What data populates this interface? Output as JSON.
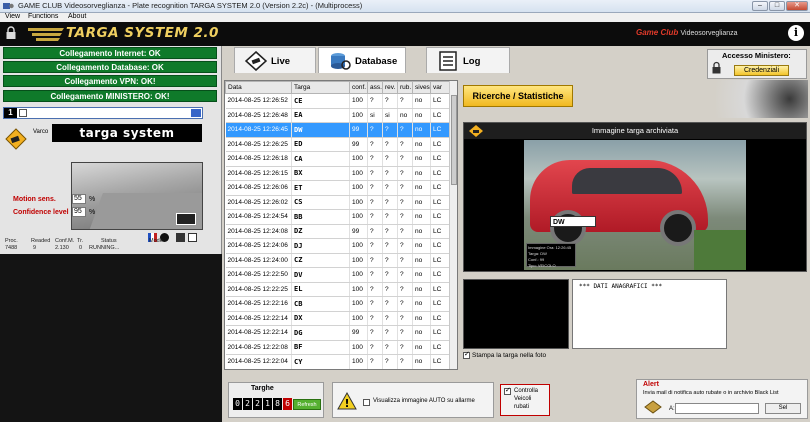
{
  "window": {
    "title": "GAME CLUB Videosorveglianza - Plate recognition TARGA SYSTEM 2.0 (Version 2.2c) - (Multiprocess)",
    "controls": [
      "–",
      "□",
      "✕"
    ]
  },
  "menu": [
    "View",
    "Functions",
    "About"
  ],
  "header": {
    "logo": "TARGA SYSTEM 2.0",
    "brand": "Game Club",
    "brand_sub": "Videosorveglianza",
    "info": "i"
  },
  "status": [
    "Collegamento Internet: OK",
    "Collegamento Database: OK",
    "Collegamento VPN: OK!",
    "Collegamento MINISTERO: OK!"
  ],
  "camera": {
    "number": "1",
    "varco_label": "Varco",
    "varco_name": "targa system",
    "motion_label": "Motion sens.",
    "motion_value": "55",
    "confidence_label": "Confidence level",
    "confidence_value": "95",
    "unit": "%",
    "stats_headers": [
      "Proc.",
      "Readed",
      "Conf.M.",
      "Tr.",
      "Status",
      "Mode"
    ],
    "stats_values": [
      "7488",
      "9",
      "2.130",
      "0",
      "RUNNING...",
      ""
    ]
  },
  "tabs": [
    {
      "label": "Live",
      "active": false
    },
    {
      "label": "Database",
      "active": true
    },
    {
      "label": "Log",
      "active": false
    }
  ],
  "accesso": {
    "title": "Accesso Ministero:",
    "button": "Credenziali"
  },
  "table": {
    "headers": [
      "Data",
      "Targa",
      "conf.",
      "ass.",
      "rev.",
      "rub.",
      "sives",
      "var"
    ],
    "rows": [
      [
        "2014-08-25 12:26:52",
        "CE",
        "100",
        "?",
        "?",
        "?",
        "no",
        "LC"
      ],
      [
        "2014-08-25 12:26:48",
        "EA",
        "100",
        "si",
        "si",
        "no",
        "no",
        "LC"
      ],
      [
        "2014-08-25 12:26:45",
        "DW",
        "99",
        "?",
        "?",
        "?",
        "no",
        "LC"
      ],
      [
        "2014-08-25 12:26:25",
        "ED",
        "99",
        "?",
        "?",
        "?",
        "no",
        "LC"
      ],
      [
        "2014-08-25 12:26:18",
        "CA",
        "100",
        "?",
        "?",
        "?",
        "no",
        "LC"
      ],
      [
        "2014-08-25 12:26:15",
        "BX",
        "100",
        "?",
        "?",
        "?",
        "no",
        "LC"
      ],
      [
        "2014-08-25 12:26:06",
        "ET",
        "100",
        "?",
        "?",
        "?",
        "no",
        "LC"
      ],
      [
        "2014-08-25 12:26:02",
        "CS",
        "100",
        "?",
        "?",
        "?",
        "no",
        "LC"
      ],
      [
        "2014-08-25 12:24:54",
        "BB",
        "100",
        "?",
        "?",
        "?",
        "no",
        "LC"
      ],
      [
        "2014-08-25 12:24:08",
        "DZ",
        "99",
        "?",
        "?",
        "?",
        "no",
        "LC"
      ],
      [
        "2014-08-25 12:24:06",
        "DJ",
        "100",
        "?",
        "?",
        "?",
        "no",
        "LC"
      ],
      [
        "2014-08-25 12:24:00",
        "CZ",
        "100",
        "?",
        "?",
        "?",
        "no",
        "LC"
      ],
      [
        "2014-08-25 12:22:50",
        "DV",
        "100",
        "?",
        "?",
        "?",
        "no",
        "LC"
      ],
      [
        "2014-08-25 12:22:25",
        "EL",
        "100",
        "?",
        "?",
        "?",
        "no",
        "LC"
      ],
      [
        "2014-08-25 12:22:16",
        "CB",
        "100",
        "?",
        "?",
        "?",
        "no",
        "LC"
      ],
      [
        "2014-08-25 12:22:14",
        "DX",
        "100",
        "?",
        "?",
        "?",
        "no",
        "LC"
      ],
      [
        "2014-08-25 12:22:14",
        "DG",
        "99",
        "?",
        "?",
        "?",
        "no",
        "LC"
      ],
      [
        "2014-08-25 12:22:08",
        "BF",
        "100",
        "?",
        "?",
        "?",
        "no",
        "LC"
      ],
      [
        "2014-08-25 12:22:04",
        "CY",
        "100",
        "?",
        "?",
        "?",
        "no",
        "LC"
      ]
    ],
    "selected_index": 2
  },
  "ricerche_button": "Ricerche / Statistiche",
  "archive": {
    "title": "Immagine targa archiviata",
    "plate": "DW",
    "caption": [
      "Immagine Ora: 12:26:45",
      "Targa: DW",
      "Conf.: 99",
      "Tipo: VEICOLO"
    ]
  },
  "anagrafica": "*** DATI ANAGRAFICI ***",
  "stampa": "Stampa la targa nella foto",
  "targhe": {
    "title": "Targhe",
    "digits": [
      "0",
      "2",
      "2",
      "1",
      "8",
      "6"
    ],
    "refresh": "Refresh"
  },
  "warn": {
    "text": "Visualizza immagine AUTO su allarme"
  },
  "controlla": {
    "text": [
      "Controlla",
      "Veicoli",
      "rubati"
    ]
  },
  "alert": {
    "title": "Alert",
    "text": "Invia mail di notifica auto rubate o in archivio Black List",
    "to_label": "A:",
    "send": "Sel"
  },
  "colors": {
    "status_green": "#0f7a2a",
    "selection_blue": "#3399ff",
    "logo_gold": "#f0d060",
    "alert_red": "#c00000"
  }
}
